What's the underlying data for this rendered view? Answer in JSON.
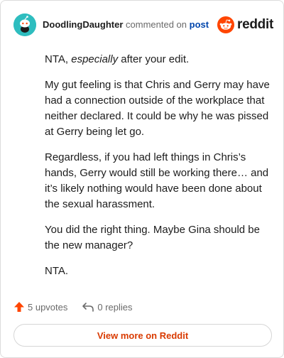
{
  "header": {
    "username": "DoodlingDaughter",
    "commented_text": "commented on",
    "post_link": "post",
    "brand_word": "reddit",
    "brand_color": "#ff4500",
    "avatar_color": "#2ebdbf"
  },
  "comment": {
    "p0_prefix": "NTA, ",
    "p0_emphasis": "especially",
    "p0_suffix": " after your edit.",
    "p1": "My gut feeling is that Chris and Gerry may have had a connection outside of the workplace that neither declared. It could be why he was pissed at Gerry being let go.",
    "p2": "Regardless, if you had left things in Chris’s hands, Gerry would still be working there… and it’s likely nothing would have been done about the sexual harassment.",
    "p3": "You did the right thing. Maybe Gina should be the new manager?",
    "p4": "NTA."
  },
  "actions": {
    "upvotes": "5 upvotes",
    "replies": "0 replies",
    "upvote_icon": "upvote-arrow-icon",
    "reply_icon": "reply-arrow-icon"
  },
  "footer": {
    "view_more": "View more on Reddit"
  }
}
